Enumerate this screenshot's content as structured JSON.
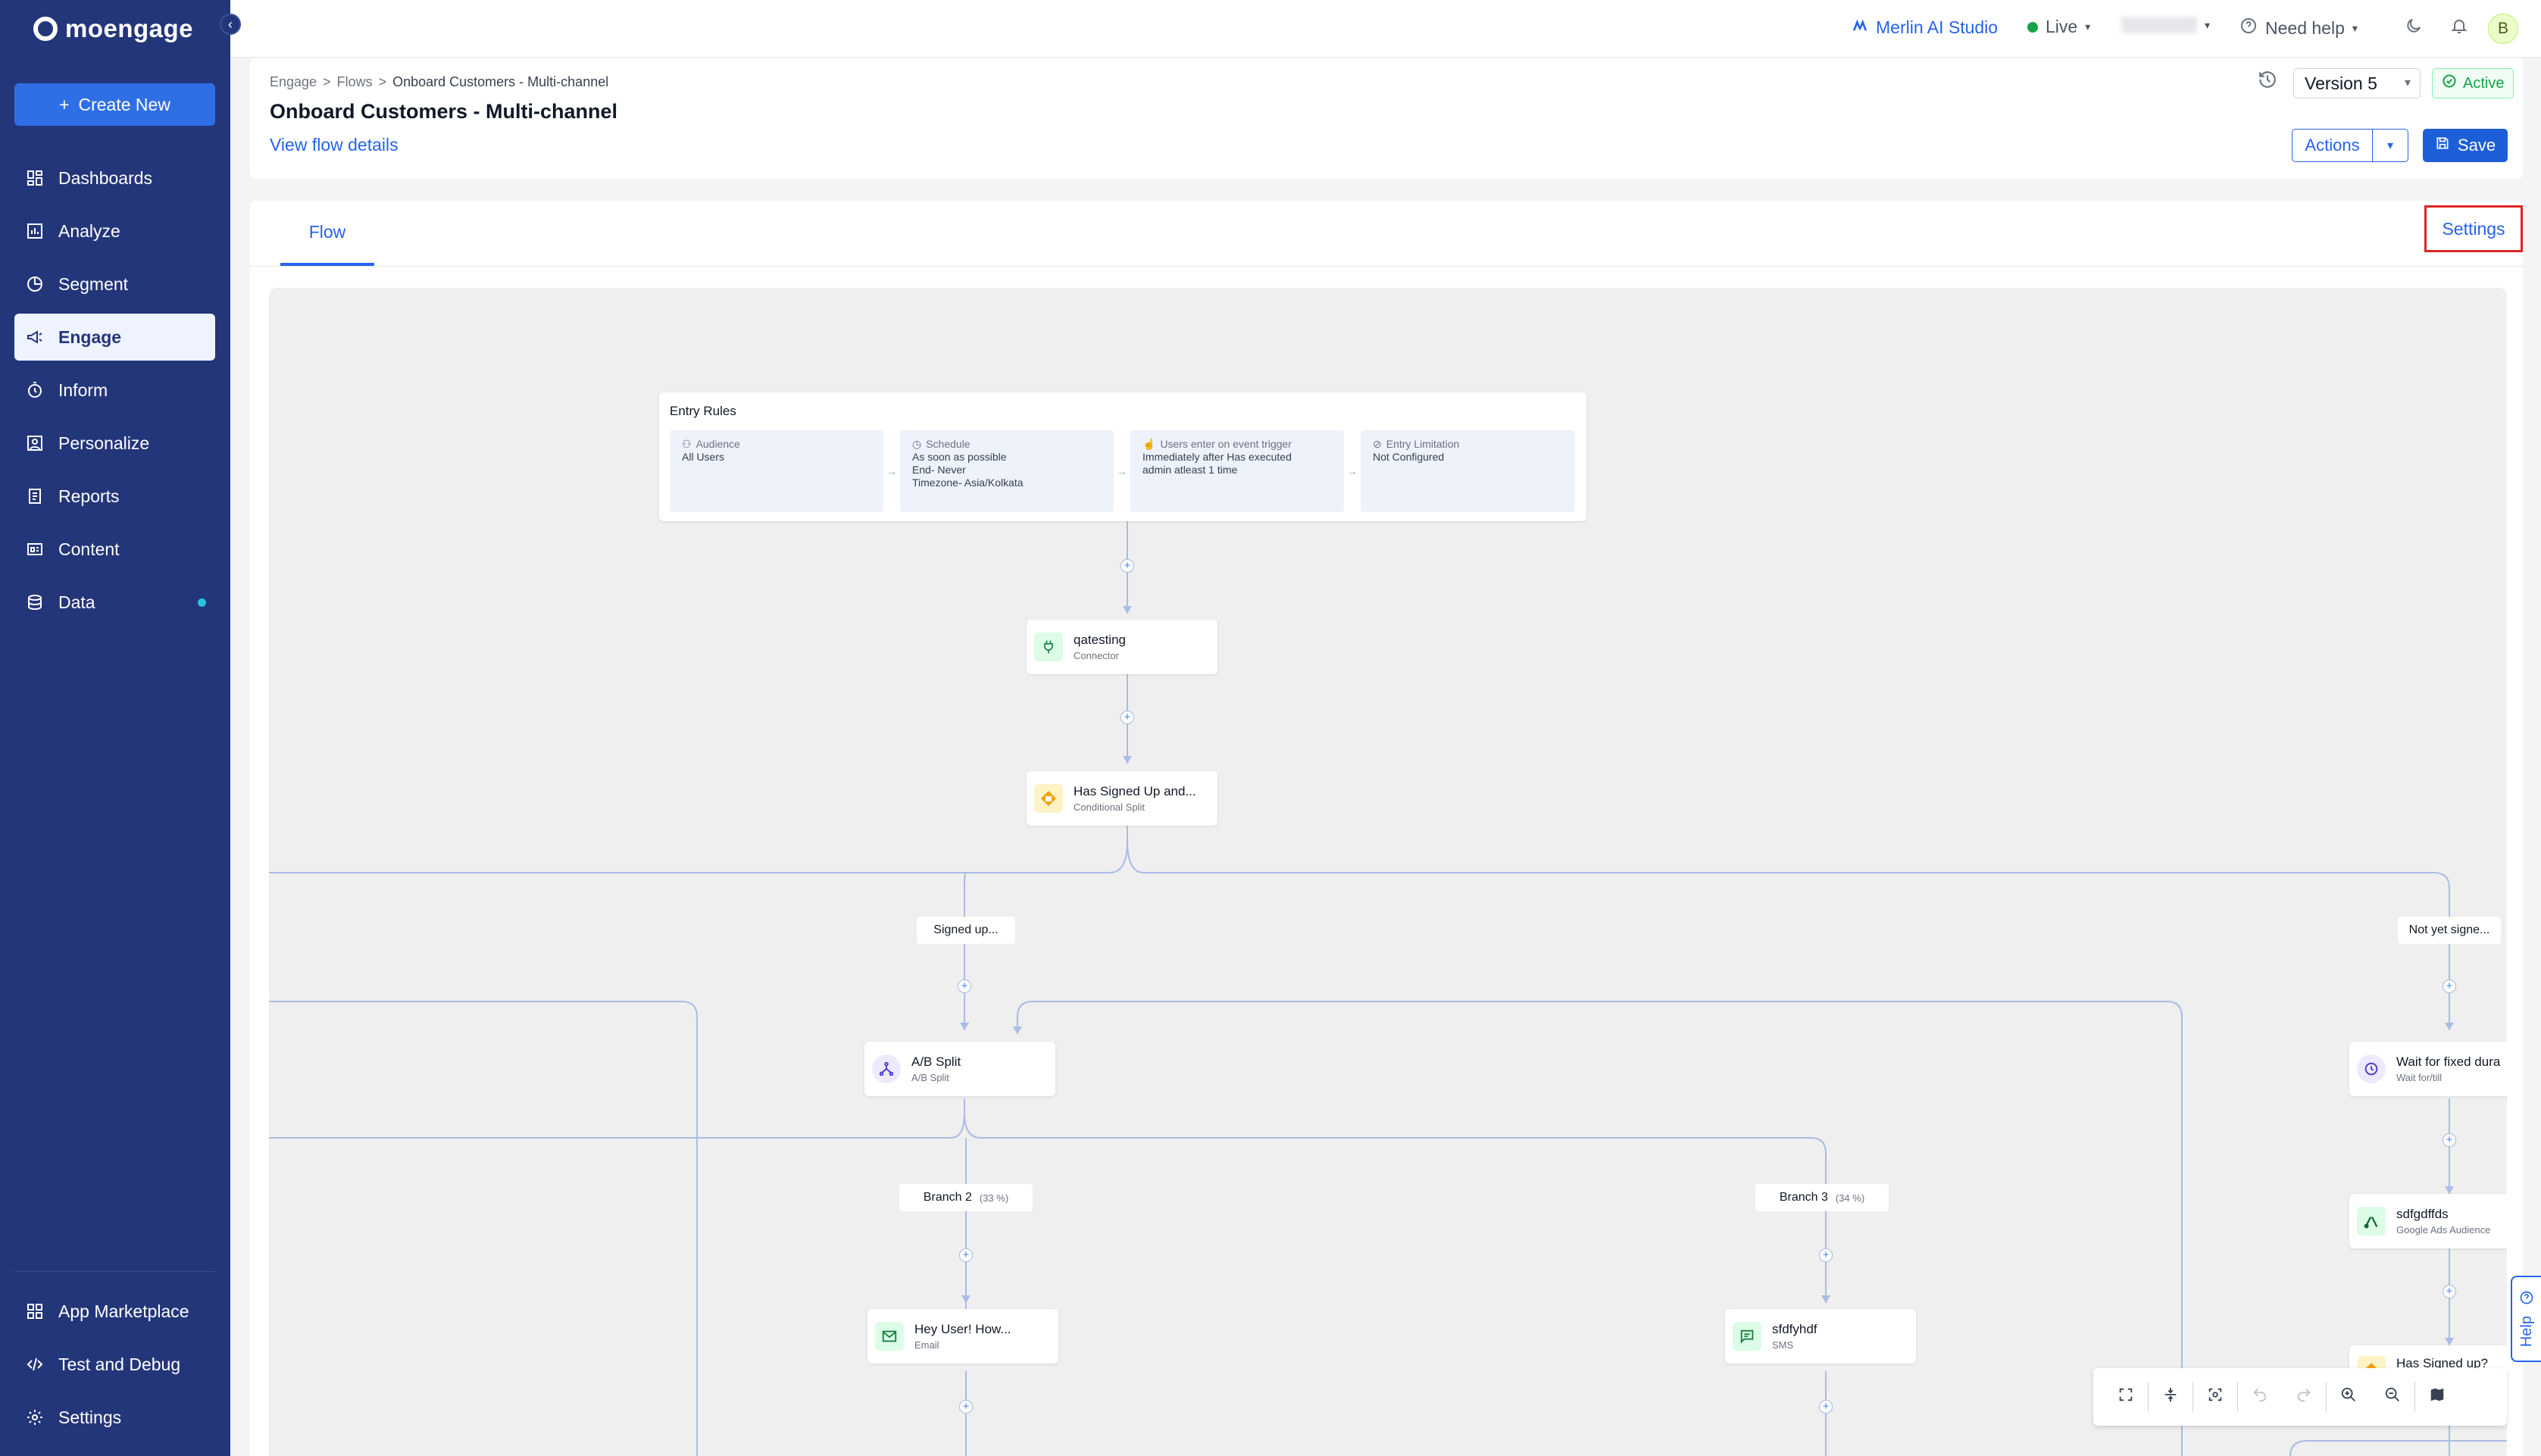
{
  "brand": {
    "name": "moengage"
  },
  "sidebar": {
    "create_label": "Create New",
    "items": [
      {
        "label": "Dashboards",
        "icon": "dashboard-icon"
      },
      {
        "label": "Analyze",
        "icon": "chart-icon"
      },
      {
        "label": "Segment",
        "icon": "pie-icon"
      },
      {
        "label": "Engage",
        "icon": "megaphone-icon",
        "active": true
      },
      {
        "label": "Inform",
        "icon": "stopwatch-icon"
      },
      {
        "label": "Personalize",
        "icon": "person-frame-icon"
      },
      {
        "label": "Reports",
        "icon": "report-icon"
      },
      {
        "label": "Content",
        "icon": "content-icon"
      },
      {
        "label": "Data",
        "icon": "database-icon",
        "badge_color": "#29c4e0"
      }
    ],
    "bottom_items": [
      {
        "label": "App Marketplace",
        "icon": "grid-icon"
      },
      {
        "label": "Test and Debug",
        "icon": "code-icon"
      },
      {
        "label": "Settings",
        "icon": "gear-icon"
      }
    ]
  },
  "topbar": {
    "merlin_label": "Merlin AI Studio",
    "env_label": "Live",
    "help_label": "Need help",
    "avatar_initial": "B"
  },
  "header": {
    "breadcrumb": [
      "Engage",
      "Flows",
      "Onboard Customers - Multi-channel"
    ],
    "title": "Onboard Customers - Multi-channel",
    "view_details": "View flow details",
    "version": "Version 5",
    "status": "Active",
    "actions_label": "Actions",
    "save_label": "Save"
  },
  "tabs": {
    "flow": "Flow",
    "settings": "Settings"
  },
  "flow": {
    "entry": {
      "title": "Entry Rules",
      "boxes": [
        {
          "head": "Audience",
          "lines": [
            "All Users"
          ]
        },
        {
          "head": "Schedule",
          "lines": [
            "As soon as possible",
            "End- Never",
            "Timezone- Asia/Kolkata"
          ]
        },
        {
          "head": "Users enter on event trigger",
          "lines": [
            "Immediately after Has executed",
            "admin atleast 1 time"
          ]
        },
        {
          "head": "Entry Limitation",
          "lines": [
            "Not Configured"
          ]
        }
      ]
    },
    "nodes": {
      "connector": {
        "title": "qatesting",
        "sub": "Connector"
      },
      "split": {
        "title": "Has Signed Up and...",
        "sub": "Conditional Split"
      },
      "ab": {
        "title": "A/B Split",
        "sub": "A/B Split"
      },
      "email": {
        "title": "Hey User! How...",
        "sub": "Email"
      },
      "sms": {
        "title": "sfdfyhdf",
        "sub": "SMS"
      },
      "wait": {
        "title": "Wait for fixed dura",
        "sub": "Wait for/till"
      },
      "google": {
        "title": "sdfgdffds",
        "sub": "Google Ads Audience"
      },
      "signed": {
        "title": "Has Signed up?",
        "sub": ""
      }
    },
    "labels": {
      "signed_up": "Signed up...",
      "not_yet": "Not yet signe...",
      "branch2": "Branch 2",
      "branch2_pct": "(33 %)",
      "branch3": "Branch 3",
      "branch3_pct": "(34 %)"
    }
  },
  "help_tab": "Help",
  "colors": {
    "sidebar": "#24367a",
    "accent": "#2563eb",
    "active_green": "#16a34a",
    "highlight_red": "#dc2626"
  }
}
